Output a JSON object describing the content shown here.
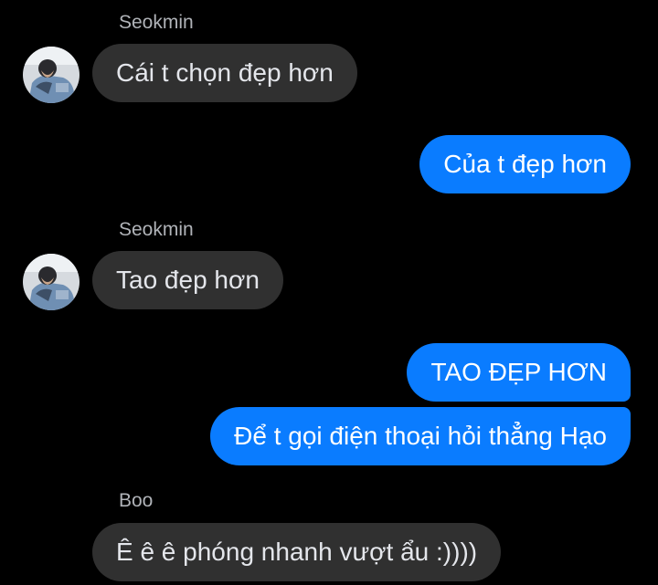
{
  "conversation": {
    "messages": [
      {
        "sender": "Seokmin",
        "text": "Cái t chọn đẹp hơn",
        "direction": "incoming"
      },
      {
        "text": "Của t đẹp hơn",
        "direction": "outgoing"
      },
      {
        "sender": "Seokmin",
        "text": "Tao đẹp hơn",
        "direction": "incoming"
      },
      {
        "text": "TAO ĐẸP HƠN",
        "direction": "outgoing"
      },
      {
        "text": "Để t gọi điện thoại hỏi thẳng Hạo",
        "direction": "outgoing"
      },
      {
        "sender": "Boo",
        "text": "Ê ê ê phóng nhanh vượt ẩu :))))",
        "direction": "incoming"
      }
    ]
  },
  "colors": {
    "background": "#000000",
    "incoming_bubble": "#303030",
    "outgoing_bubble": "#0a7cff",
    "sender_name": "#b0b3b8"
  },
  "icons": {
    "avatar": "user-avatar-photo"
  }
}
